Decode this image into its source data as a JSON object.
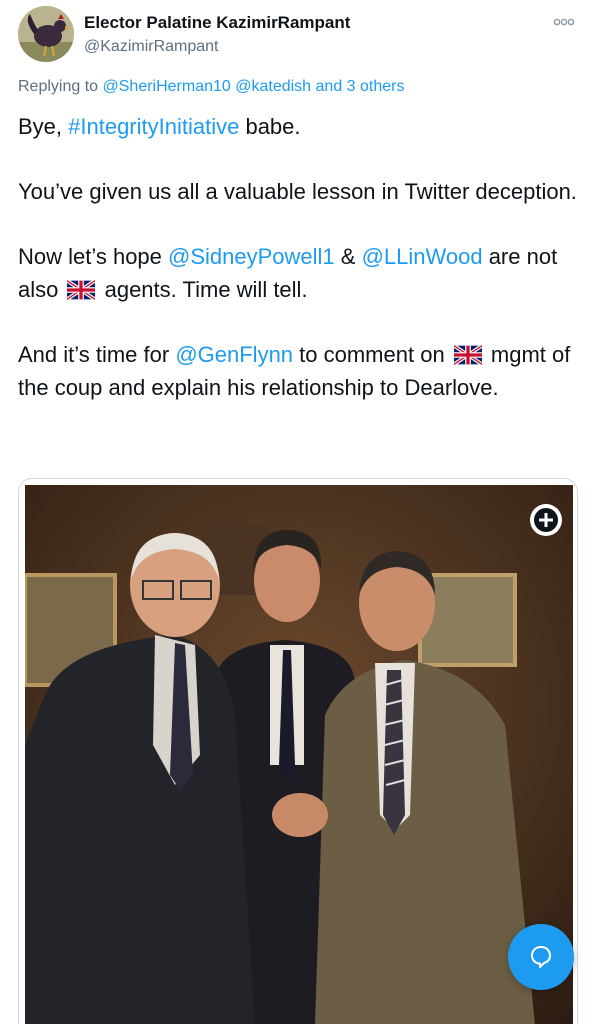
{
  "author": {
    "display_name": "Elector Palatine KazimirRampant",
    "handle": "@KazimirRampant",
    "avatar_icon": "rooster-avatar"
  },
  "reply": {
    "prefix": "Replying to ",
    "users": "@SheriHerman10 @katedish",
    "others": " and 3 others"
  },
  "tweet": {
    "p1_a": "Bye, ",
    "p1_hashtag": "#IntegrityInitiative",
    "p1_b": " babe.",
    "p2": "You’ve given us all a valuable lesson in Twitter deception.",
    "p3_a": "Now let’s hope ",
    "p3_mention1": "@SidneyPowell1",
    "p3_b": " & ",
    "p3_mention2": "@LLinWood",
    "p3_c": " are not also ",
    "p3_d": " agents. Time will tell.",
    "p4_a": "And it’s time for ",
    "p4_mention": "@GenFlynn",
    "p4_b": " to comment on ",
    "p4_c": " mgmt of the coup and explain his relationship to Dearlove."
  },
  "icons": {
    "more": "more-options-icon",
    "flag": "uk-flag-emoji",
    "expand": "plus-circle-icon",
    "fab": "speech-bubble-icon"
  },
  "colors": {
    "link": "#1d9bf0",
    "secondary_text": "#5b7083",
    "fab": "#1d9bf0"
  }
}
